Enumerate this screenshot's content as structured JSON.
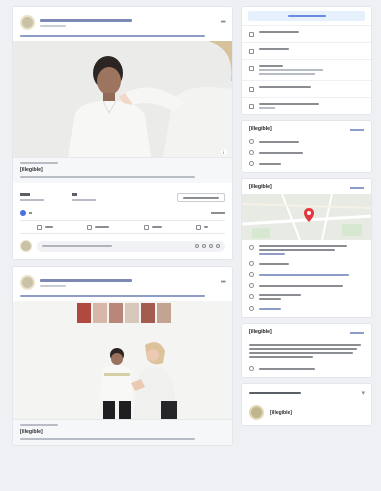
{
  "posts": [
    {
      "link_title": "[illegible]"
    },
    {
      "link_title": "[illegible]"
    }
  ],
  "sidebar": {
    "community_title": "[illegible]",
    "about_title": "[illegible]",
    "transparency_title": "[illegible]",
    "footer_page_name": "[illegible]"
  },
  "colors": {
    "link": "#385898",
    "accent": "#4a6fe0",
    "map_pin": "#e0383e",
    "page_bg": "#eef0f4"
  },
  "icons": {
    "more": "more-horizontal-icon",
    "like": "thumbs-up-icon",
    "comment": "comment-icon",
    "share": "share-icon",
    "map_pin": "map-pin-icon"
  }
}
